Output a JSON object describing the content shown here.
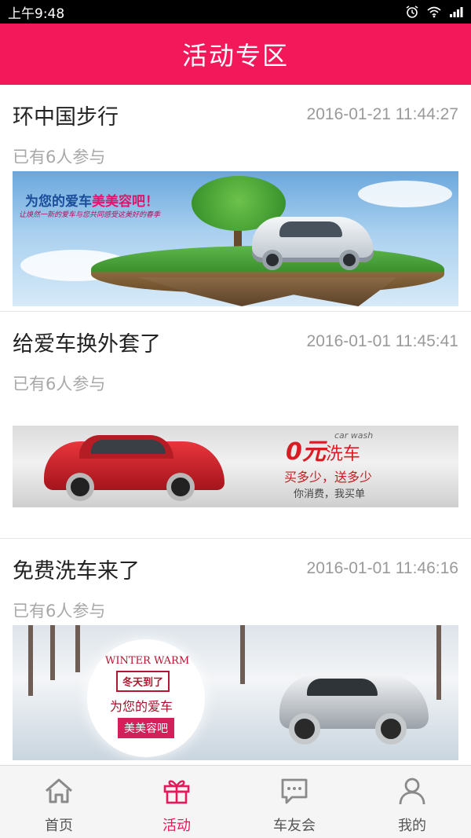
{
  "status_bar": {
    "time": "上午9:48"
  },
  "header": {
    "title": "活动专区"
  },
  "activities": [
    {
      "title": "环中国步行",
      "time": "2016-01-21 11:44:27",
      "participants": "已有6人参与",
      "banner": {
        "headline_prefix": "为您的爱车",
        "headline_highlight": "美美容吧！",
        "sub": "让焕然一新的爱车与您共同感受这美好的春季"
      }
    },
    {
      "title": "给爱车换外套了",
      "time": "2016-01-01 11:45:41",
      "participants": "已有6人参与",
      "banner": {
        "zero": "0元",
        "wash": "洗车",
        "car_wash": "car wash",
        "line1": "买多少，送多少",
        "line2": "你消费，我买单"
      }
    },
    {
      "title": "免费洗车来了",
      "time": "2016-01-01 11:46:16",
      "participants": "已有6人参与",
      "banner": {
        "winter": "WINTER WARM",
        "tag": "冬天到了",
        "line1": "为您的爱车",
        "line2": "美美容吧"
      }
    }
  ],
  "tabbar": {
    "tabs": [
      {
        "label": "首页",
        "icon": "home-icon"
      },
      {
        "label": "活动",
        "icon": "gift-icon"
      },
      {
        "label": "车友会",
        "icon": "chat-icon"
      },
      {
        "label": "我的",
        "icon": "user-icon"
      }
    ],
    "active_index": 1
  },
  "colors": {
    "accent": "#f2185a",
    "tab_active": "#e8185a"
  }
}
